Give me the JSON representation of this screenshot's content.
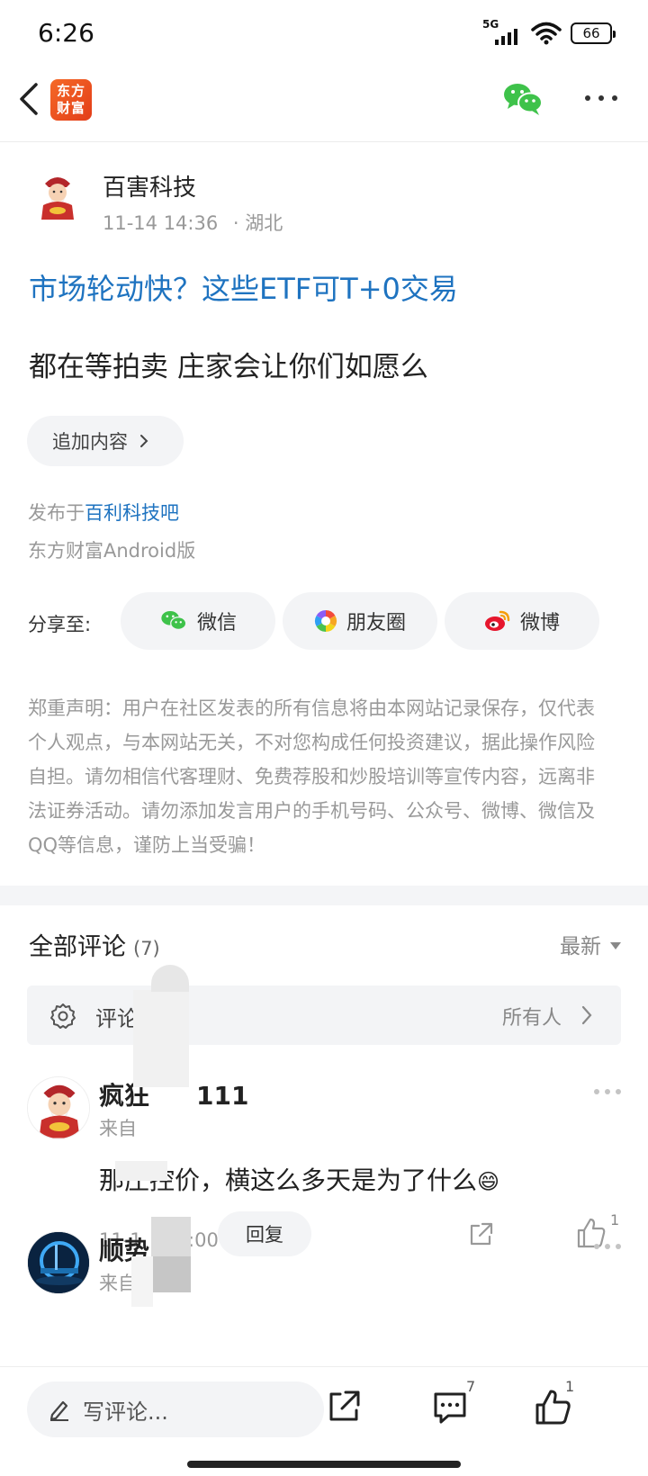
{
  "status_bar": {
    "time": "6:26",
    "network": "5G",
    "battery": "66"
  },
  "nav": {
    "logo_line1": "东方",
    "logo_line2": "财富",
    "back_icon": "chevron-left-icon",
    "wechat_icon": "wechat-icon",
    "more_icon": "more-dots-icon"
  },
  "post": {
    "author": "百害科技",
    "date": "11-14 14:36",
    "location": "· 湖北",
    "title": "市场轮动快？这些ETF可T+0交易",
    "body": "都在等拍卖 庄家会让你们如愿么",
    "append_label": "追加内容",
    "published_prefix": "发布于",
    "forum": "百利科技吧",
    "source": "东方财富Android版"
  },
  "share": {
    "label": "分享至:",
    "wechat": "微信",
    "moments": "朋友圈",
    "weibo": "微博"
  },
  "disclaimer": "郑重声明：用户在社区发表的所有信息将由本网站记录保存，仅代表个人观点，与本网站无关，不对您构成任何投资建议，据此操作风险自担。请勿相信代客理财、免费荐股和炒股培训等宣传内容，远离非法证券活动。请勿添加发言用户的手机号码、公众号、微博、微信及QQ等信息，谨防上当受骗！",
  "comments_section": {
    "title": "全部评论",
    "count": "(7)",
    "sort": "最新",
    "settings_label": "评论设置",
    "settings_value": "所有人"
  },
  "comments": [
    {
      "user_start": "疯狂",
      "user_end": "111",
      "from": "来自",
      "text": "那庄控价，横这么多天是为了什么",
      "emoji": "😄",
      "time": "11-1",
      "time_end": "5:00",
      "reply": "回复",
      "likes": "1"
    },
    {
      "user_start": "顺势",
      "from": "来自",
      "more": "···"
    }
  ],
  "bottom_bar": {
    "write_placeholder": "写评论...",
    "comment_count": "7",
    "like_count": "1"
  },
  "colors": {
    "link_blue": "#1e73c0",
    "brand_orange": "#f05a22",
    "wechat_green": "#3ec24a"
  }
}
